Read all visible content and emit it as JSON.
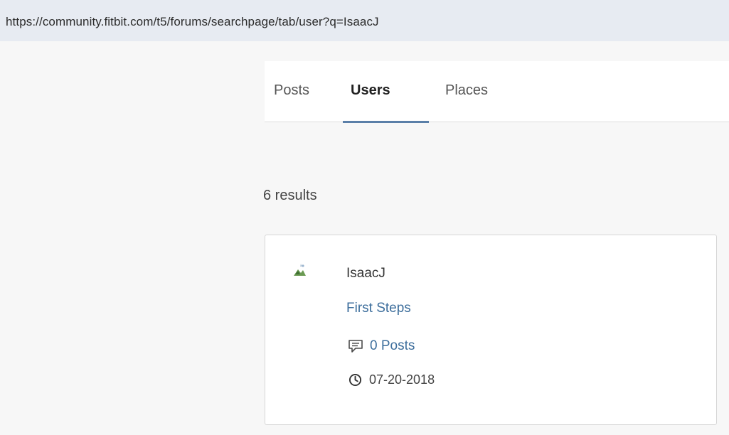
{
  "browser": {
    "url": "https://community.fitbit.com/t5/forums/searchpage/tab/user?q=IsaacJ"
  },
  "tabs": [
    {
      "label": "Posts",
      "active": false
    },
    {
      "label": "Users",
      "active": true
    },
    {
      "label": "Places",
      "active": false
    }
  ],
  "results": {
    "count_label": "6 results",
    "items": [
      {
        "username": "IsaacJ",
        "rank": "First Steps",
        "posts_label": "0 Posts",
        "date": "07-20-2018",
        "avatar_icon": "broken-image-icon",
        "posts_icon": "speech-bubble-icon",
        "date_icon": "clock-icon"
      }
    ]
  },
  "colors": {
    "link": "#3d6e9c",
    "tab_underline": "#5a7fa8",
    "address_bar": "#e7ebf2"
  }
}
